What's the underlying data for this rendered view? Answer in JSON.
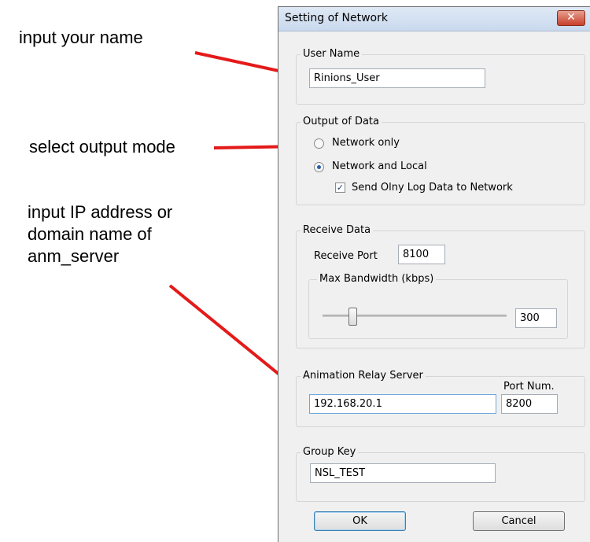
{
  "annotations": {
    "name": "input your name",
    "output": "select output mode",
    "server_line1": "input IP address or",
    "server_line2": "domain name of",
    "server_line3": "anm_server"
  },
  "colors": {
    "arrow": "#e41a1a",
    "selected_radio": "#2a5ea8"
  },
  "dialog": {
    "title": "Setting of Network",
    "close_icon": "close-icon",
    "user_name": {
      "label": "User Name",
      "value": "Rinions_User"
    },
    "output": {
      "label": "Output of Data",
      "option1": "Network only",
      "option2": "Network and Local",
      "selected": "Network and Local",
      "checkbox_label": "Send Olny Log Data to Network",
      "checkbox_checked": true
    },
    "receive": {
      "label": "Receive Data",
      "port_label": "Receive Port",
      "port_value": "8100",
      "bandwidth_label": "Max Bandwidth (kbps)",
      "bandwidth_value": "300"
    },
    "relay": {
      "label": "Animation Relay Server",
      "port_label": "Port Num.",
      "address": "192.168.20.1",
      "port": "8200"
    },
    "group_key": {
      "label": "Group Key",
      "value": "NSL_TEST"
    },
    "buttons": {
      "ok": "OK",
      "cancel": "Cancel"
    }
  }
}
